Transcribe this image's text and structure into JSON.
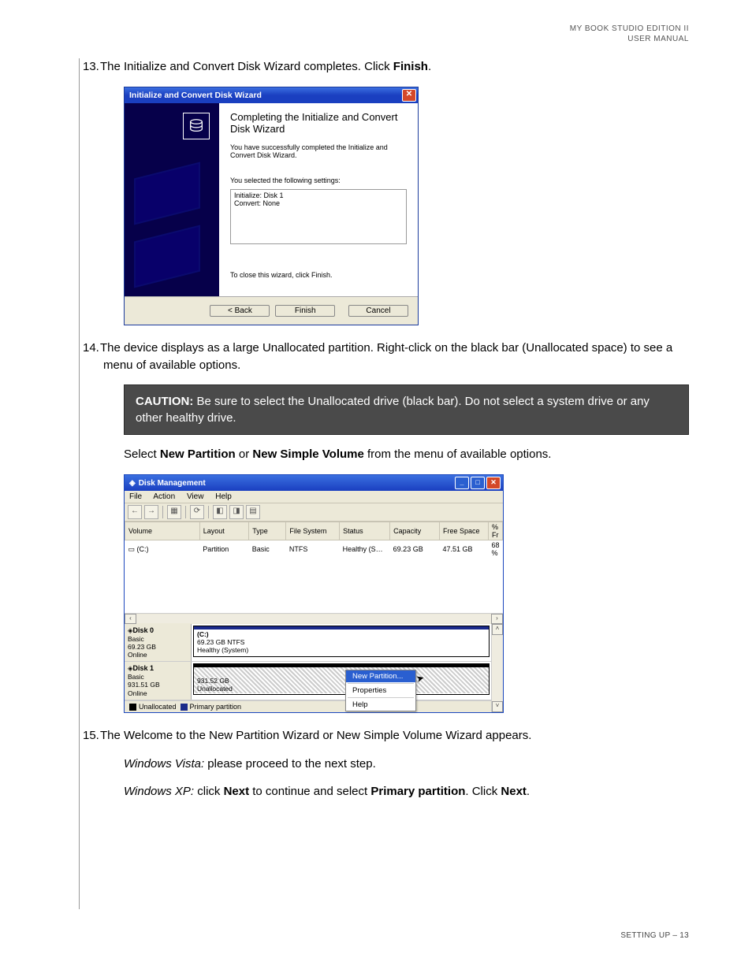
{
  "header": {
    "line1": "MY BOOK STUDIO EDITION II",
    "line2": "USER MANUAL"
  },
  "step13": {
    "num": "13.",
    "text_a": "The Initialize and Convert Disk Wizard completes. Click ",
    "bold": "Finish",
    "text_b": "."
  },
  "wizard": {
    "title": "Initialize and Convert Disk Wizard",
    "heading": "Completing the Initialize and Convert Disk Wizard",
    "success": "You have successfully completed the Initialize and Convert Disk Wizard.",
    "settings_label": "You selected the following settings:",
    "setting1": "Initialize: Disk 1",
    "setting2": "Convert: None",
    "close_hint": "To close this wizard, click Finish.",
    "btn_back": "< Back",
    "btn_finish": "Finish",
    "btn_cancel": "Cancel"
  },
  "step14": {
    "num": "14.",
    "text": "The device displays as a large Unallocated partition. Right-click on the black bar (Unallocated space) to see a menu of available options."
  },
  "caution": {
    "label": "CAUTION:",
    "text": " Be sure to select the Unallocated drive (black bar). Do not select a system drive or any other healthy drive."
  },
  "select_line": {
    "a": "Select ",
    "b1": "New Partition",
    "c": " or ",
    "b2": "New Simple Volume",
    "d": " from the menu of available options."
  },
  "dm": {
    "title": "Disk Management",
    "menu": {
      "file": "File",
      "action": "Action",
      "view": "View",
      "help": "Help"
    },
    "cols": {
      "volume": "Volume",
      "layout": "Layout",
      "type": "Type",
      "filesystem": "File System",
      "status": "Status",
      "capacity": "Capacity",
      "free": "Free Space",
      "pct": "% Fr"
    },
    "row": {
      "volume": "(C:)",
      "layout": "Partition",
      "type": "Basic",
      "filesystem": "NTFS",
      "status": "Healthy (S…",
      "capacity": "69.23 GB",
      "free": "47.51 GB",
      "pct": "68 %"
    },
    "disk0": {
      "name": "Disk 0",
      "type": "Basic",
      "size": "69.23 GB",
      "state": "Online",
      "vol_label": "(C:)",
      "vol_size": "69.23 GB NTFS",
      "vol_status": "Healthy (System)"
    },
    "disk1": {
      "name": "Disk 1",
      "type": "Basic",
      "size": "931.51 GB",
      "state": "Online",
      "vol_size": "931.52 GB",
      "vol_status": "Unallocated"
    },
    "legend": {
      "unalloc": "Unallocated",
      "primary": "Primary partition"
    },
    "menu_items": {
      "new": "New Partition...",
      "props": "Properties",
      "help": "Help"
    }
  },
  "step15": {
    "num": "15.",
    "line1": "The Welcome to the New Partition Wizard or New Simple Volume Wizard appears.",
    "vista_label": "Windows Vista:",
    "vista_text": " please proceed to the next step.",
    "xp_label": "Windows XP:",
    "xp_a": " click ",
    "xp_b1": "Next",
    "xp_c": " to continue and select ",
    "xp_b2": "Primary partition",
    "xp_d": ". Click ",
    "xp_b3": "Next",
    "xp_e": "."
  },
  "footer": "SETTING UP – 13"
}
